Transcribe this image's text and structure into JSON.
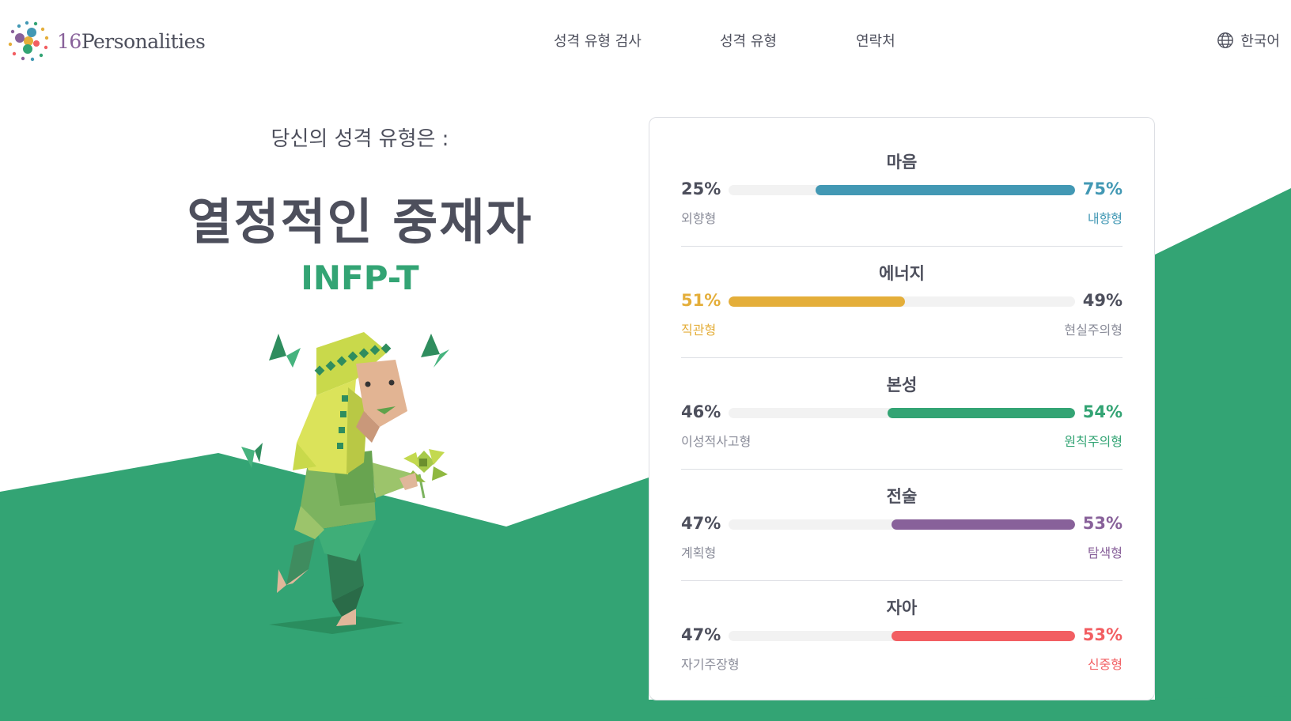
{
  "brand": {
    "number": "16",
    "name": "Personalities"
  },
  "nav": {
    "items": [
      {
        "label": "성격 유형 검사"
      },
      {
        "label": "성격 유형"
      },
      {
        "label": "연락처"
      }
    ],
    "language": "한국어"
  },
  "hero": {
    "subtitle": "당신의 성격 유형은 :",
    "title": "열정적인 중재자",
    "code": "INFP-T"
  },
  "traits": [
    {
      "title": "마음",
      "left_pct": "25%",
      "right_pct": "75%",
      "left_label": "외향형",
      "right_label": "내향형",
      "dominant": "right",
      "value": 0.75,
      "color": "#4298b4"
    },
    {
      "title": "에너지",
      "left_pct": "51%",
      "right_pct": "49%",
      "left_label": "직관형",
      "right_label": "현실주의형",
      "dominant": "left",
      "value": 0.51,
      "color": "#e4ae3a"
    },
    {
      "title": "본성",
      "left_pct": "46%",
      "right_pct": "54%",
      "left_label": "이성적사고형",
      "right_label": "원칙주의형",
      "dominant": "right",
      "value": 0.54,
      "color": "#33a474"
    },
    {
      "title": "전술",
      "left_pct": "47%",
      "right_pct": "53%",
      "left_label": "계획형",
      "right_label": "탐색형",
      "dominant": "right",
      "value": 0.53,
      "color": "#88619a"
    },
    {
      "title": "자아",
      "left_pct": "47%",
      "right_pct": "53%",
      "left_label": "자기주장형",
      "right_label": "신중형",
      "dominant": "right",
      "value": 0.53,
      "color": "#f25e62"
    }
  ],
  "colors": {
    "text": "#4d4f5c",
    "muted": "#8a8c99",
    "accent_green": "#33a474",
    "hill_green": "#33a474"
  }
}
